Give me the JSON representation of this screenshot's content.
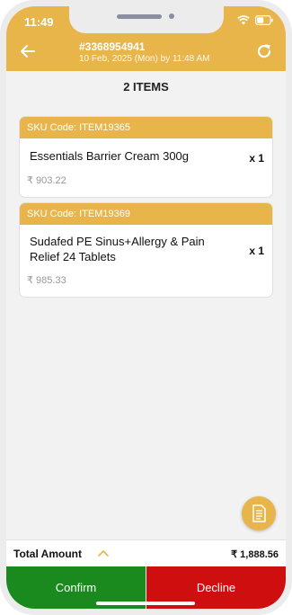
{
  "status_bar": {
    "time": "11:49"
  },
  "header": {
    "order_id": "#3368954941",
    "order_subtitle": "10 Feb, 2025 (Mon) by 11:48 AM",
    "accent": "#e8b54a"
  },
  "items_title": "2 ITEMS",
  "items": [
    {
      "sku": "SKU Code: ITEM19365",
      "name": "Essentials Barrier Cream 300g",
      "qty": "x 1",
      "price": "₹ 903.22"
    },
    {
      "sku": "SKU Code: ITEM19369",
      "name": "Sudafed PE Sinus+Allergy & Pain Relief 24 Tablets",
      "qty": "x 1",
      "price": "₹ 985.33"
    }
  ],
  "total": {
    "label": "Total Amount",
    "value": "₹ 1,888.56"
  },
  "actions": {
    "confirm": "Confirm",
    "decline": "Decline",
    "confirm_color": "#1a8a1f",
    "decline_color": "#cf0f0f"
  }
}
